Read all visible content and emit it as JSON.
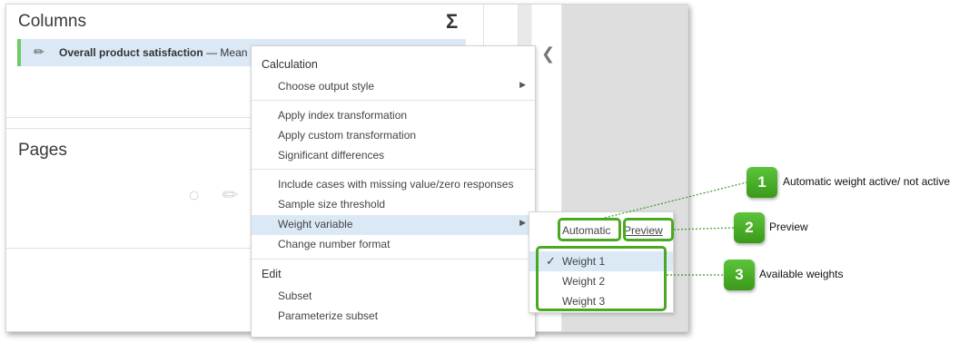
{
  "panel": {
    "columns_title": "Columns",
    "sigma": "Σ",
    "column_chip_name": "Overall product satisfaction",
    "column_chip_sep": "—",
    "column_chip_stat": "Mean",
    "pages_title": "Pages"
  },
  "menu": {
    "calculation_header": "Calculation",
    "items_calc": [
      {
        "label": "Choose output style",
        "submenu": true
      },
      {
        "label": "Apply index transformation"
      },
      {
        "label": "Apply custom transformation"
      },
      {
        "label": "Significant differences"
      },
      {
        "label": "Include cases with missing value/zero responses"
      },
      {
        "label": "Sample size threshold"
      },
      {
        "label": "Weight variable",
        "submenu": true,
        "active": true
      },
      {
        "label": "Change number format"
      }
    ],
    "edit_header": "Edit",
    "items_edit": [
      {
        "label": "Subset"
      },
      {
        "label": "Parameterize subset"
      }
    ]
  },
  "submenu": {
    "automatic": "Automatic",
    "preview": "Preview",
    "weights": [
      {
        "label": "Weight 1",
        "checked": true
      },
      {
        "label": "Weight 2"
      },
      {
        "label": "Weight 3"
      }
    ]
  },
  "annotations": [
    {
      "number": "1",
      "text": "Automatic weight active/ not active"
    },
    {
      "number": "2",
      "text": "Preview"
    },
    {
      "number": "3",
      "text": "Available weights"
    }
  ],
  "colors": {
    "accent_green": "#4aa821",
    "selection_blue": "#dbe9f7"
  }
}
